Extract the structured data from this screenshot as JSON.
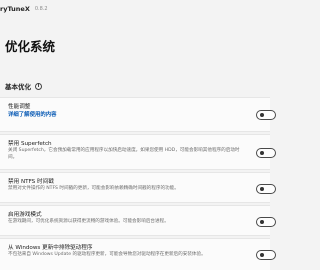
{
  "app": {
    "name": "ryTuneX",
    "version": "0.8.2"
  },
  "page": {
    "title": "优化系统"
  },
  "section": {
    "title": "基本优化",
    "info_icon_glyph": "i"
  },
  "settings": [
    {
      "title": "性能调整",
      "link": "详细了解使用的内容",
      "description": "",
      "toggle_on": false
    },
    {
      "title": "禁用 Superfetch",
      "link": "",
      "description": "关闭 Superfetch，它会预加载常用的应用程序以加快启动速度。如果您使用 HDD，可能会影响其他程序的启动时间。",
      "toggle_on": false
    },
    {
      "title": "禁用 NTFS 时间戳",
      "link": "",
      "description": "禁用对文件操作的 NTFS 时间戳的更新，可能会影响依赖精确时间戳的程序的功能。",
      "toggle_on": false
    },
    {
      "title": "启用游戏模式",
      "link": "",
      "description": "在游戏期间，可优化系统资源以获得更流畅的游戏体验。可能会影响后台进程。",
      "toggle_on": false
    },
    {
      "title": "从 Windows 更新中排除驱动程序",
      "link": "",
      "description": "不包括来自 Windows Update 的驱动程序更新，可能会导致您对驱动程序在更新后的安装体验。",
      "toggle_on": false
    }
  ]
}
